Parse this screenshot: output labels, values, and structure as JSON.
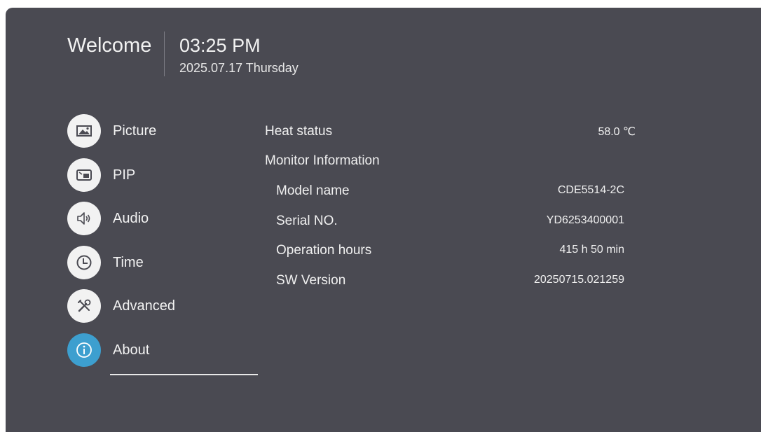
{
  "header": {
    "welcome": "Welcome",
    "time": "03:25 PM",
    "date": "2025.07.17 Thursday"
  },
  "menu": {
    "items": [
      {
        "label": "Picture",
        "icon": "picture-icon"
      },
      {
        "label": "PIP",
        "icon": "pip-icon"
      },
      {
        "label": "Audio",
        "icon": "speaker-icon"
      },
      {
        "label": "Time",
        "icon": "clock-icon"
      },
      {
        "label": "Advanced",
        "icon": "tools-icon"
      },
      {
        "label": "About",
        "icon": "info-icon",
        "selected": true
      }
    ]
  },
  "about": {
    "heat_status_label": "Heat status",
    "heat_status_value": "58.0 ℃",
    "monitor_info_label": "Monitor Information",
    "rows": [
      {
        "label": "Model name",
        "value": "CDE5514-2C"
      },
      {
        "label": "Serial NO.",
        "value": "YD6253400001"
      },
      {
        "label": "Operation hours",
        "value": "415 h 50 min"
      },
      {
        "label": "SW Version",
        "value": "20250715.021259"
      }
    ]
  },
  "colors": {
    "panel": "#4a4a52",
    "accent": "#3d9fcf",
    "text": "#f2f2f2"
  }
}
